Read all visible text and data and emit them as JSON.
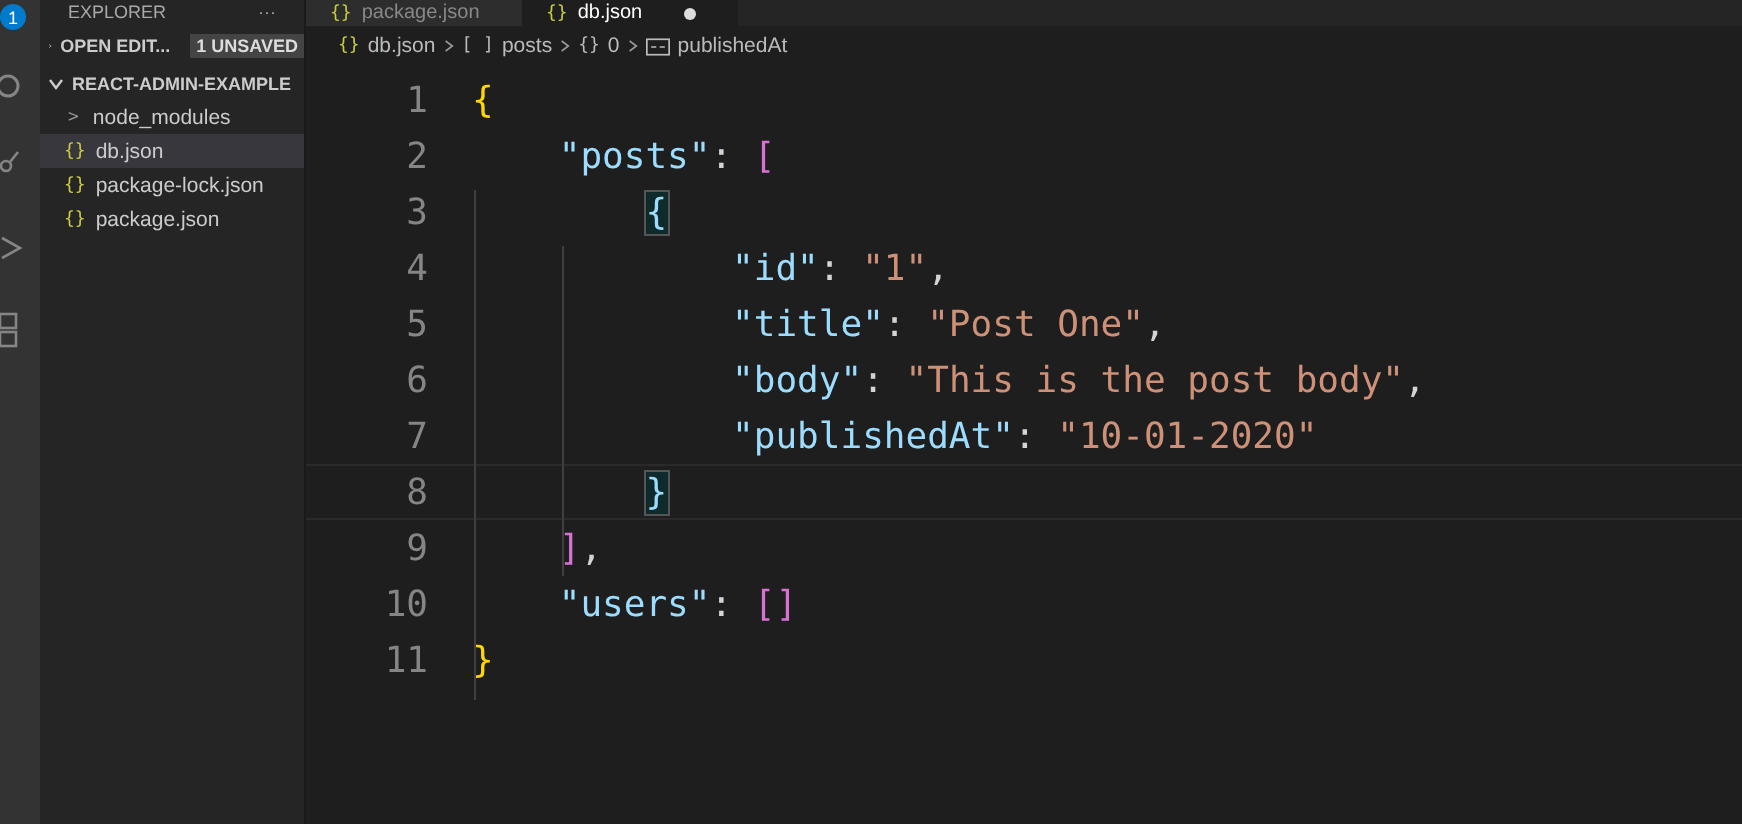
{
  "activity_bar": {
    "badge": "1"
  },
  "sidebar": {
    "title": "EXPLORER",
    "more": "···",
    "open_editors": {
      "label": "OPEN EDIT...",
      "badge": "1 UNSAVED",
      "expanded": false
    },
    "project": {
      "label": "REACT-ADMIN-EXAMPLE",
      "expanded": true
    },
    "items": [
      {
        "kind": "folder",
        "label": "node_modules",
        "icon": ">",
        "selected": false
      },
      {
        "kind": "file",
        "label": "db.json",
        "icon": "{}",
        "selected": true
      },
      {
        "kind": "file",
        "label": "package-lock.json",
        "icon": "{}",
        "selected": false
      },
      {
        "kind": "file",
        "label": "package.json",
        "icon": "{}",
        "selected": false
      }
    ]
  },
  "tabs": [
    {
      "label": "package.json",
      "icon": "{}",
      "selected": false,
      "modified": false
    },
    {
      "label": "db.json",
      "icon": "{}",
      "selected": true,
      "modified": true
    }
  ],
  "breadcrumb": [
    {
      "kind": "file",
      "icon": "{}",
      "label": "db.json"
    },
    {
      "kind": "array",
      "icon": "[ ]",
      "label": "posts"
    },
    {
      "kind": "object",
      "icon": "{}",
      "label": "0"
    },
    {
      "kind": "property",
      "label": "publishedAt"
    }
  ],
  "lines": [
    {
      "number": "1",
      "current": false,
      "tokens": [
        {
          "kind": "brace1",
          "text": "{"
        }
      ]
    },
    {
      "number": "2",
      "current": false,
      "tokens": [
        {
          "kind": "key",
          "text": "    \"posts\""
        },
        {
          "kind": "punct",
          "text": ": "
        },
        {
          "kind": "brace2",
          "text": "["
        }
      ]
    },
    {
      "number": "3",
      "current": false,
      "tokens": [
        {
          "kind": "match",
          "text": "        {"
        }
      ]
    },
    {
      "number": "4",
      "current": false,
      "tokens": [
        {
          "kind": "key",
          "text": "            \"id\""
        },
        {
          "kind": "punct",
          "text": ": "
        },
        {
          "kind": "string",
          "text": "\"1\""
        },
        {
          "kind": "punct",
          "text": ","
        }
      ]
    },
    {
      "number": "5",
      "current": false,
      "tokens": [
        {
          "kind": "key",
          "text": "            \"title\""
        },
        {
          "kind": "punct",
          "text": ": "
        },
        {
          "kind": "string",
          "text": "\"Post One\""
        },
        {
          "kind": "punct",
          "text": ","
        }
      ]
    },
    {
      "number": "6",
      "current": false,
      "tokens": [
        {
          "kind": "key",
          "text": "            \"body\""
        },
        {
          "kind": "punct",
          "text": ": "
        },
        {
          "kind": "string",
          "text": "\"This is the post body\""
        },
        {
          "kind": "punct",
          "text": ","
        }
      ]
    },
    {
      "number": "7",
      "current": false,
      "tokens": [
        {
          "kind": "key",
          "text": "            \"publishedAt\""
        },
        {
          "kind": "punct",
          "text": ": "
        },
        {
          "kind": "string",
          "text": "\"10-01-2020\""
        }
      ]
    },
    {
      "number": "8",
      "current": true,
      "tokens": [
        {
          "kind": "match",
          "text": "        }"
        }
      ]
    },
    {
      "number": "9",
      "current": false,
      "tokens": [
        {
          "kind": "brace2",
          "text": "    ]"
        },
        {
          "kind": "punct",
          "text": ","
        }
      ]
    },
    {
      "number": "10",
      "current": false,
      "tokens": [
        {
          "kind": "key",
          "text": "    \"users\""
        },
        {
          "kind": "punct",
          "text": ": "
        },
        {
          "kind": "brace2",
          "text": "[]"
        }
      ]
    },
    {
      "number": "11",
      "current": false,
      "tokens": [
        {
          "kind": "brace1",
          "text": "}"
        }
      ]
    }
  ]
}
